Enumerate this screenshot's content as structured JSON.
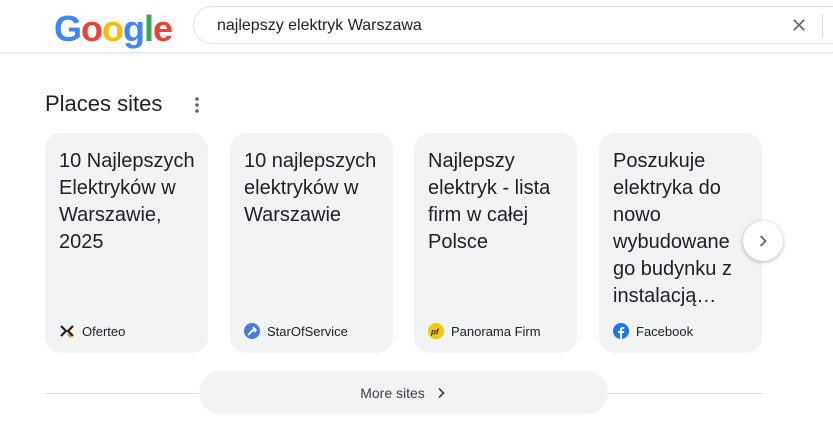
{
  "logo": {
    "letters": [
      {
        "char": "G",
        "color": "#4285F4"
      },
      {
        "char": "o",
        "color": "#EA4335"
      },
      {
        "char": "o",
        "color": "#FBBC05"
      },
      {
        "char": "g",
        "color": "#4285F4"
      },
      {
        "char": "l",
        "color": "#34A853"
      },
      {
        "char": "e",
        "color": "#EA4335"
      }
    ]
  },
  "search": {
    "query": "najlepszy elektryk Warszawa",
    "clear_icon": "close-icon"
  },
  "section": {
    "title": "Places sites",
    "menu_icon": "more-vert-icon"
  },
  "cards": [
    {
      "title": "10 Najlepszych Elektryków w Warszawie, 2025",
      "source": "Oferteo",
      "icon": "oferteo-icon"
    },
    {
      "title": "10 najlepszych elektryków w Warszawie",
      "source": "StarOfService",
      "icon": "starofservice-icon"
    },
    {
      "title": "Najlepszy elektryk - lista firm w całej Polsce",
      "source": "Panorama Firm",
      "icon": "panorama-firm-icon"
    },
    {
      "title": "Poszukuje elektryka do nowo wybudowanego budynku z instalacją…",
      "source": "Facebook",
      "icon": "facebook-icon",
      "color": "#1877F2"
    }
  ],
  "carousel": {
    "next_icon": "chevron-right-icon"
  },
  "more_sites": {
    "label": "More sites",
    "icon": "chevron-right-icon"
  }
}
